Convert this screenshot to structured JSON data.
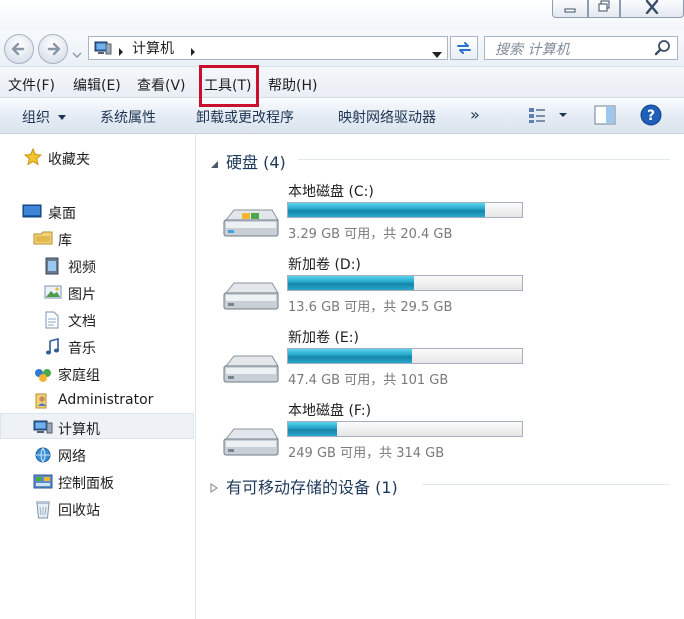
{
  "window": {
    "title": "计算机"
  },
  "address": {
    "path": "计算机",
    "search_placeholder": "搜索 计算机"
  },
  "menu": [
    {
      "label": "文件(F)"
    },
    {
      "label": "编辑(E)"
    },
    {
      "label": "查看(V)"
    },
    {
      "label": "工具(T)"
    },
    {
      "label": "帮助(H)"
    }
  ],
  "toolbar": {
    "organize": "组织",
    "system_properties": "系统属性",
    "uninstall": "卸载或更改程序",
    "map_drive": "映射网络驱动器",
    "more": "»"
  },
  "nav": {
    "favorites": "收藏夹",
    "desktop": "桌面",
    "libraries": "库",
    "videos": "视频",
    "pictures": "图片",
    "documents": "文档",
    "music": "音乐",
    "homegroup": "家庭组",
    "administrator": "Administrator",
    "computer": "计算机",
    "network": "网络",
    "control_panel": "控制面板",
    "recycle_bin": "回收站"
  },
  "content": {
    "hard_disks_title": "硬盘 (4)",
    "removable_title": "有可移动存储的设备 (1)",
    "drives": [
      {
        "name": "本地磁盘 (C:)",
        "detail": "3.29 GB 可用，共 20.4 GB",
        "used_fraction": 0.84
      },
      {
        "name": "新加卷 (D:)",
        "detail": "13.6 GB 可用，共 29.5 GB",
        "used_fraction": 0.54
      },
      {
        "name": "新加卷 (E:)",
        "detail": "47.4 GB 可用，共 101 GB",
        "used_fraction": 0.53
      },
      {
        "name": "本地磁盘 (F:)",
        "detail": "249 GB 可用，共 314 GB",
        "used_fraction": 0.21
      }
    ]
  },
  "colors": {
    "highlight": "#c8102e",
    "progress": "#1b8fb5"
  }
}
